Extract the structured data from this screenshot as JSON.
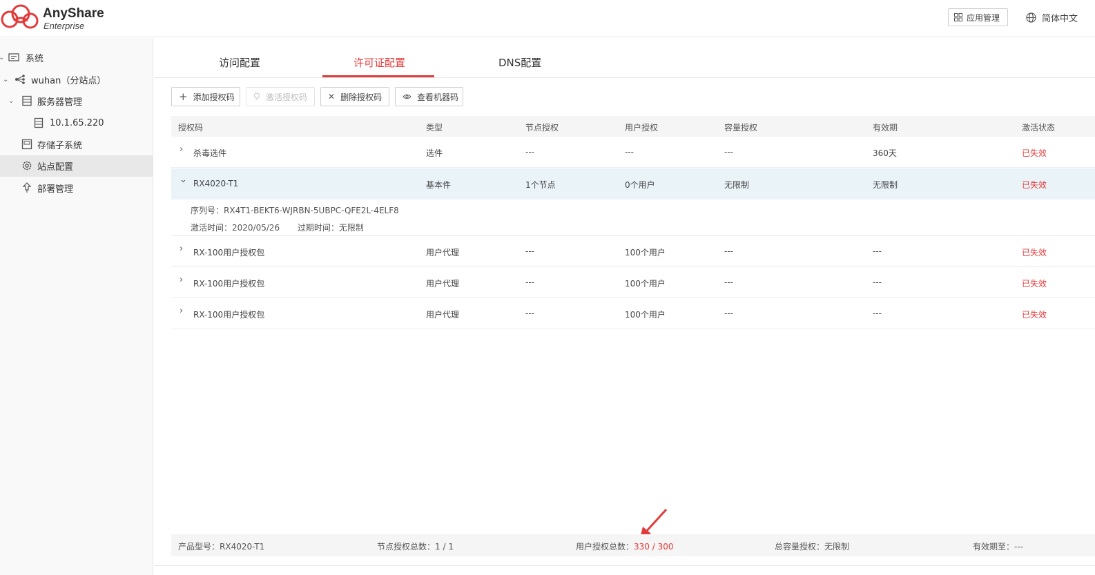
{
  "header": {
    "brand_name": "AnyShare",
    "brand_sub": "Enterprise",
    "app_manage_label": "应用管理",
    "language_label": "简体中文",
    "accent_color": "#e33b3b"
  },
  "sidebar": {
    "items": [
      {
        "label": "系统",
        "icon": "system-icon"
      },
      {
        "label": "wuhan（分站点）",
        "icon": "network-icon"
      },
      {
        "label": "服务器管理",
        "icon": "server-icon"
      },
      {
        "label": "10.1.65.220",
        "icon": "server-node-icon"
      },
      {
        "label": "存储子系统",
        "icon": "storage-icon"
      },
      {
        "label": "站点配置",
        "icon": "gear-icon",
        "active": true
      },
      {
        "label": "部署管理",
        "icon": "deploy-icon"
      }
    ]
  },
  "tabs": [
    {
      "label": "访问配置"
    },
    {
      "label": "许可证配置",
      "active": true
    },
    {
      "label": "DNS配置"
    }
  ],
  "toolbar": {
    "add_label": "添加授权码",
    "activate_label": "激活授权码",
    "delete_label": "删除授权码",
    "view_label": "查看机器码"
  },
  "table": {
    "columns": [
      "授权码",
      "类型",
      "节点授权",
      "用户授权",
      "容量授权",
      "有效期",
      "激活状态"
    ],
    "rows": [
      {
        "code": "杀毒选件",
        "type": "选件",
        "node": "---",
        "user": "---",
        "capacity": "---",
        "validity": "360天",
        "status": "已失效"
      },
      {
        "code": "RX4020-T1",
        "type": "基本件",
        "node": "1个节点",
        "user": "0个用户",
        "capacity": "无限制",
        "validity": "无限制",
        "status": "已失效",
        "expanded": true
      },
      {
        "code": "RX-100用户授权包",
        "type": "用户代理",
        "node": "---",
        "user": "100个用户",
        "capacity": "---",
        "validity": "---",
        "status": "已失效"
      },
      {
        "code": "RX-100用户授权包",
        "type": "用户代理",
        "node": "---",
        "user": "100个用户",
        "capacity": "---",
        "validity": "---",
        "status": "已失效"
      },
      {
        "code": "RX-100用户授权包",
        "type": "用户代理",
        "node": "---",
        "user": "100个用户",
        "capacity": "---",
        "validity": "---",
        "status": "已失效"
      }
    ],
    "detail": {
      "serial_label": "序列号：",
      "serial_value": "RX4T1-BEKT6-WJRBN-5UBPC-QFE2L-4ELF8",
      "activated_label": "激活时间：",
      "activated_value": "2020/05/26",
      "expire_label": "过期时间：",
      "expire_value": "无限制"
    }
  },
  "footer": {
    "model_label": "产品型号：",
    "model_value": "RX4020-T1",
    "node_total_label": "节点授权总数：",
    "node_total_value": "1 / 1",
    "user_total_label": "用户授权总数：",
    "user_total_value": "330 / 300",
    "capacity_label": "总容量授权：",
    "capacity_value": "无限制",
    "expiry_label": "有效期至：",
    "expiry_value": "---"
  }
}
